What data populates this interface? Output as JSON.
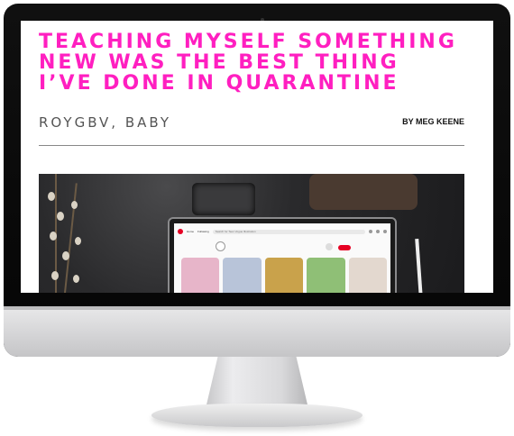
{
  "article": {
    "headline_line1": "Teaching myself something",
    "headline_line2": "new was the best thing",
    "headline_line3": "I’ve done in quarantine",
    "category": "ROYGBV, BABY",
    "byline": "BY MEG KEENE"
  },
  "hero_screen": {
    "nav_home": "Home",
    "nav_following": "Following",
    "search_placeholder": "Search for Teen Vogue Illustration",
    "pin_colors": [
      "#e7b5c9",
      "#b8c4d9",
      "#c9a24b",
      "#8fbf76",
      "#e3d8cf"
    ]
  },
  "colors": {
    "accent": "#ff1fc0",
    "monitor_frame": "#0b0b0b",
    "chin": "#d6d6d8",
    "pinterest": "#e60023"
  }
}
